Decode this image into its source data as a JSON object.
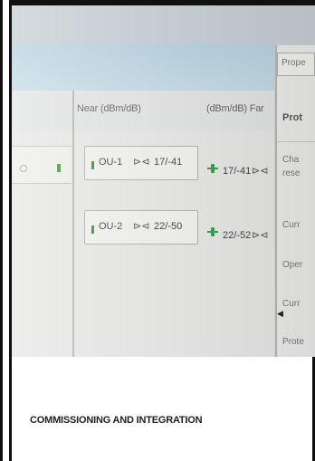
{
  "table": {
    "header_near": "Near (dBm/dB)",
    "header_far": "(dBm/dB) Far",
    "rows": [
      {
        "name": "OU-1",
        "near": "17/-41",
        "far": "17/-41"
      },
      {
        "name": "OU-2",
        "near": "22/-50",
        "far": "22/-52"
      }
    ]
  },
  "properties_panel": {
    "tab": "Prope",
    "title": "Prot",
    "rows": [
      "Cha",
      "rese",
      "Curr",
      "Oper",
      "Curr",
      "Prote"
    ]
  },
  "connector_symbol": "⊳⊲",
  "icons": {
    "ou_status_led": "green-led-icon",
    "near_connector": "connector-icon",
    "far_connector": "connector-icon",
    "link": "link-icon",
    "collapse": "collapse-arrow-icon",
    "left_radio": "radio-icon"
  },
  "colors": {
    "led_green": "#2e9a2e",
    "link_green": "#3aa24a",
    "header_band": "#c5dbe6"
  },
  "caption": "COMMISSIONING AND INTEGRATION"
}
